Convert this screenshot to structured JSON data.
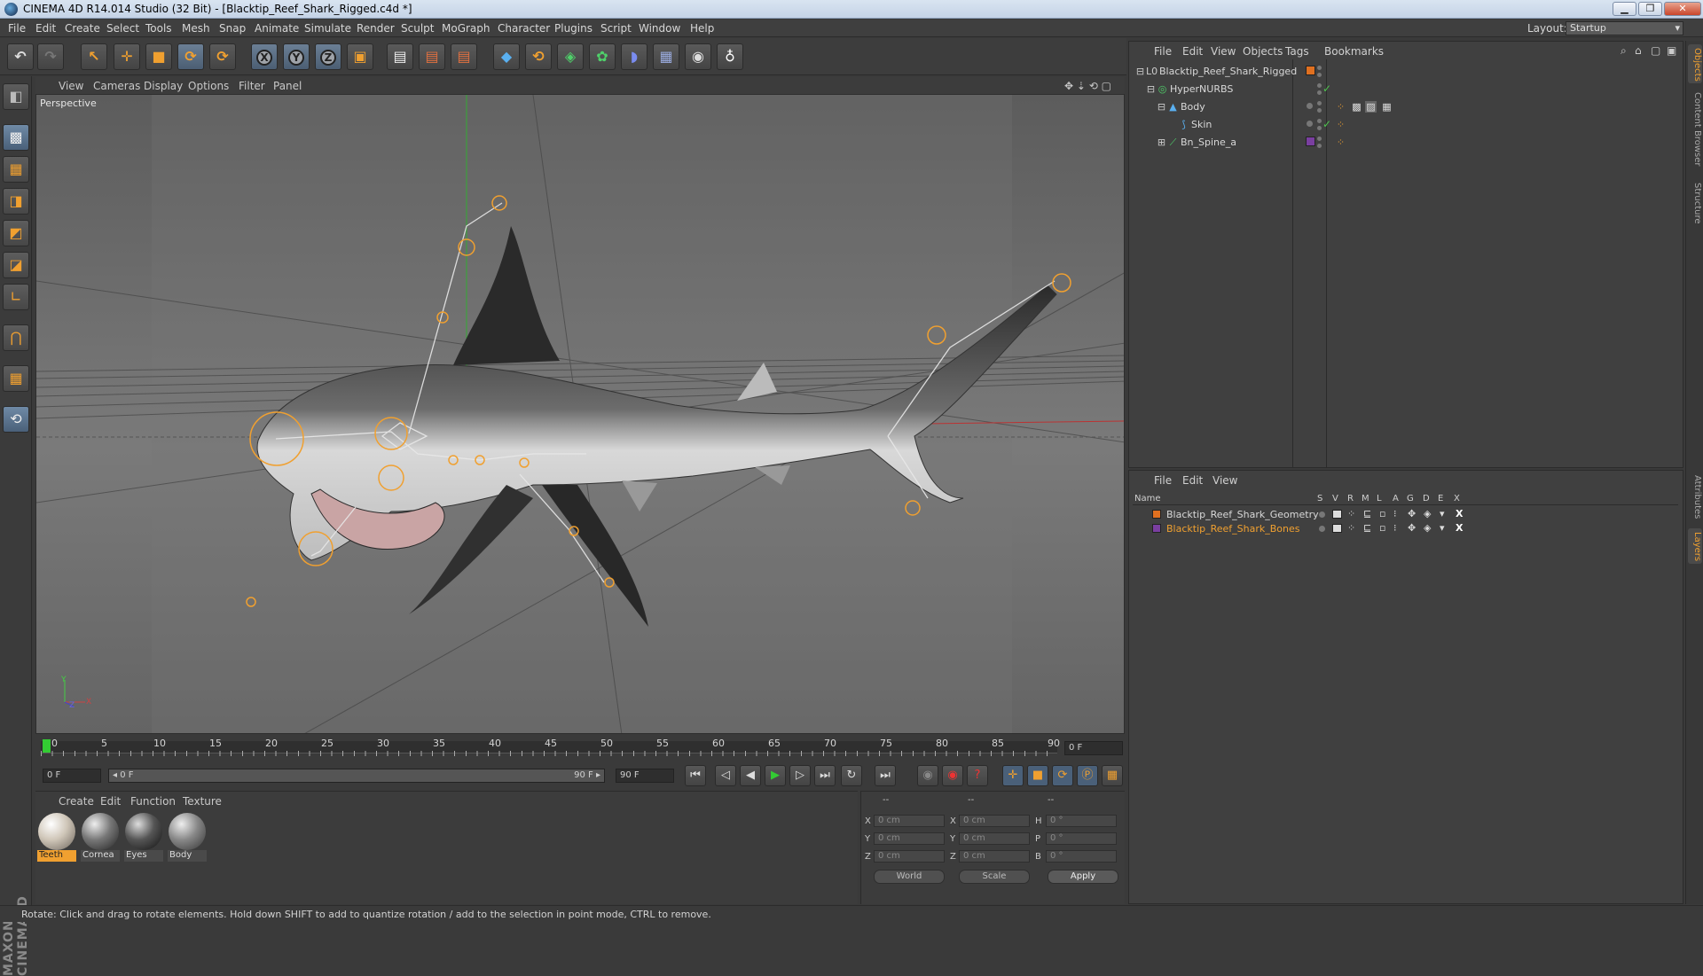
{
  "window": {
    "title": "CINEMA 4D R14.014 Studio (32 Bit) - [Blacktip_Reef_Shark_Rigged.c4d *]",
    "min": "▁",
    "max": "❐",
    "close": "✕"
  },
  "menubar": {
    "items": [
      "File",
      "Edit",
      "Create",
      "Select",
      "Tools",
      "Mesh",
      "Snap",
      "Animate",
      "Simulate",
      "Render",
      "Sculpt",
      "MoGraph",
      "Character",
      "Plugins",
      "Script",
      "Window",
      "Help"
    ],
    "layout_label": "Layout:",
    "layout_value": "Startup"
  },
  "toolbar": {
    "undo": "↶",
    "redo": "↷",
    "tools": [
      {
        "name": "live-selection-icon",
        "glyph": "↖"
      },
      {
        "name": "move-icon",
        "glyph": "✛"
      },
      {
        "name": "scale-icon",
        "glyph": "■"
      },
      {
        "name": "rotate-icon",
        "glyph": "⟳"
      },
      {
        "name": "recent-tool-icon",
        "glyph": "⟳"
      }
    ],
    "axes": [
      "X",
      "Y",
      "Z"
    ],
    "coord_system": "▣",
    "render": [
      "▤",
      "▤",
      "▤"
    ],
    "objects": [
      "◆",
      "⟲",
      "◈",
      "✿",
      "◗",
      "▦",
      "◉",
      "♁"
    ]
  },
  "left_tools": [
    "◧",
    "▩",
    "▦",
    "◨",
    "◩",
    "◪",
    "∟",
    "⋂",
    "▦",
    "⟲"
  ],
  "maxon_logo": "MAXON CINEMA4D",
  "viewport": {
    "menu": [
      "View",
      "Cameras",
      "Display",
      "Options",
      "Filter",
      "Panel"
    ],
    "label": "Perspective",
    "nav_icons": "✥ ⇣ ⟲ ▢",
    "axis_y": "Y",
    "axis_z": "Z",
    "axis_x": "X"
  },
  "timeline": {
    "ticks": [
      "0",
      "5",
      "10",
      "15",
      "20",
      "25",
      "30",
      "35",
      "40",
      "45",
      "50",
      "55",
      "60",
      "65",
      "70",
      "75",
      "80",
      "85",
      "90"
    ],
    "current_frame": "0 F"
  },
  "transport": {
    "start_field": "0 F",
    "range_start": "◂ 0 F",
    "range_end": "90 F ▸",
    "end_field": "90 F",
    "buttons": [
      "⏮",
      "◁",
      "◀",
      "▶",
      "▷",
      "⏭",
      "↻",
      "⏭"
    ],
    "key_buttons": [
      "◉",
      "◉",
      "?",
      "✛",
      "■",
      "⟳",
      "Ⓟ",
      "▦",
      "▤"
    ]
  },
  "material_manager": {
    "menu": [
      "Create",
      "Edit",
      "Function",
      "Texture"
    ],
    "materials": [
      {
        "name": "Teeth",
        "selected": true
      },
      {
        "name": "Cornea",
        "selected": false
      },
      {
        "name": "Eyes",
        "selected": false
      },
      {
        "name": "Body",
        "selected": false
      }
    ]
  },
  "coordinates": {
    "headers": [
      "--",
      "--",
      "--"
    ],
    "rows": [
      {
        "a": "X",
        "av": "0 cm",
        "b": "X",
        "bv": "0 cm",
        "c": "H",
        "cv": "0 °"
      },
      {
        "a": "Y",
        "av": "0 cm",
        "b": "Y",
        "bv": "0 cm",
        "c": "P",
        "cv": "0 °"
      },
      {
        "a": "Z",
        "av": "0 cm",
        "b": "Z",
        "bv": "0 cm",
        "c": "B",
        "cv": "0 °"
      }
    ],
    "world": "World",
    "scale": "Scale",
    "apply": "Apply"
  },
  "status": "Rotate: Click and drag to rotate elements. Hold down SHIFT to add to quantize rotation / add to the selection in point mode, CTRL to remove.",
  "object_manager": {
    "menu": [
      "File",
      "Edit",
      "View",
      "Objects",
      "Tags",
      "Bookmarks"
    ],
    "objects": [
      {
        "name": "Blacktip_Reef_Shark_Rigged",
        "indent": 0,
        "icon": "L0",
        "chip": "#e07020"
      },
      {
        "name": "HyperNURBS",
        "indent": 1,
        "icon": "◎",
        "chip": ""
      },
      {
        "name": "Body",
        "indent": 2,
        "icon": "▲",
        "chip": ""
      },
      {
        "name": "Skin",
        "indent": 3,
        "icon": "⟆",
        "chip": ""
      },
      {
        "name": "Bn_Spine_a",
        "indent": 2,
        "icon": "⟋",
        "chip": "#7a3fa0"
      }
    ]
  },
  "layer_manager": {
    "menu": [
      "File",
      "Edit",
      "View"
    ],
    "columns": [
      "Name",
      "S",
      "V",
      "R",
      "M",
      "L",
      "A",
      "G",
      "D",
      "E",
      "X"
    ],
    "layers": [
      {
        "name": "Blacktip_Reef_Shark_Geometry",
        "color": "#e07020",
        "text_color": "#d8d8d8"
      },
      {
        "name": "Blacktip_Reef_Shark_Bones",
        "color": "#7a3fa0",
        "text_color": "#f0a030"
      }
    ]
  },
  "right_tabs": [
    "Objects",
    "Content Browser",
    "Structure",
    "Attributes",
    "Layers"
  ],
  "colors": {
    "accent": "#f0a030",
    "viewport_bg": "#6e6e6e",
    "panel": "#404040"
  }
}
